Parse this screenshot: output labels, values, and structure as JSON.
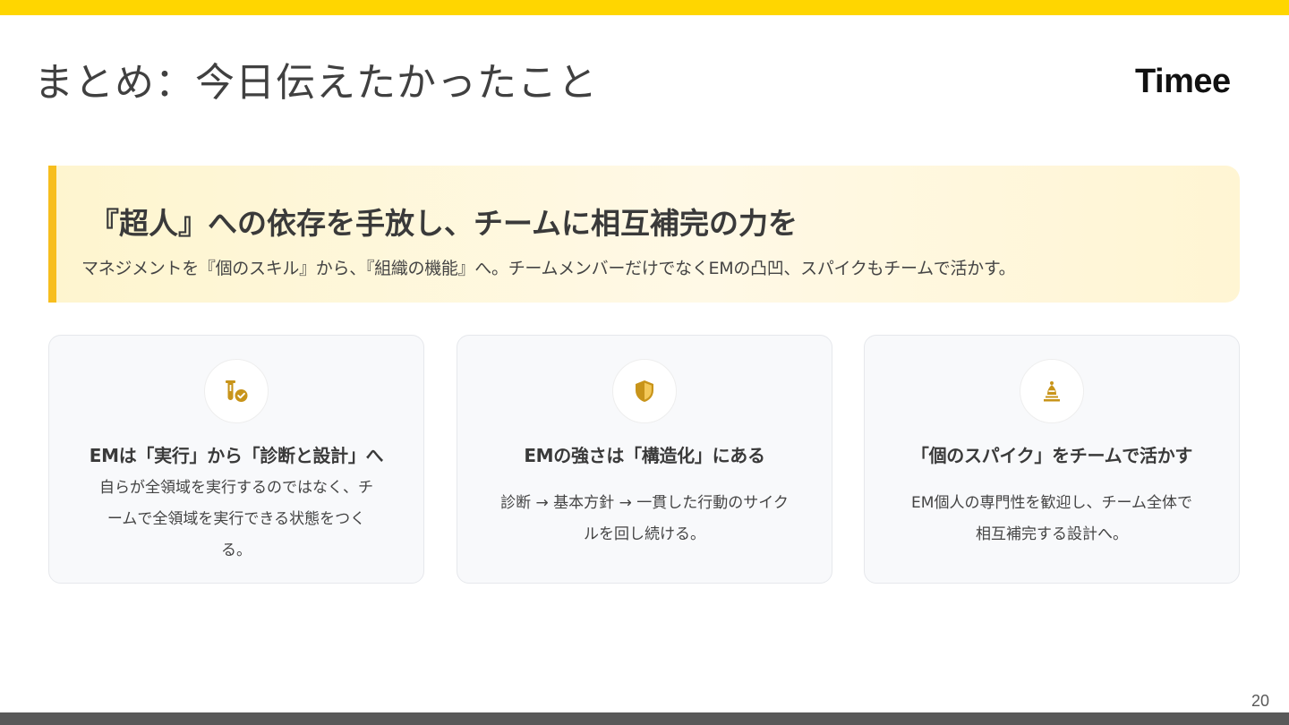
{
  "page": {
    "title": "まとめ：今日伝えたかったこと",
    "logo": "Timee",
    "page_number": "20"
  },
  "hero": {
    "title": "『超人』への依存を手放し、チームに相互補完の力を",
    "subtitle": "マネジメントを『個のスキル』から、『組織の機能』へ。チームメンバーだけでなくEMの凸凹、スパイクもチームで活かす。"
  },
  "cards": [
    {
      "icon": "flask-check-icon",
      "title": "EMは「実行」から「診断と設計」へ",
      "body": "自らが全領域を実行するのではなく、チームで全領域を実行できる状態をつくる。"
    },
    {
      "icon": "shield-icon",
      "title": "EMの強さは「構造化」にある",
      "body": "診断 → 基本方針 → 一貫した行動のサイクルを回し続ける。"
    },
    {
      "icon": "chess-bishop-icon",
      "title": "「個のスパイク」をチームで活かす",
      "body": "EM個人の専門性を歓迎し、チーム全体で相互補完する設計へ。"
    }
  ],
  "colors": {
    "accent_yellow": "#ffd600",
    "hero_border": "#f7be1e",
    "icon_gold": "#c8941a",
    "footer_gray": "#595959"
  }
}
